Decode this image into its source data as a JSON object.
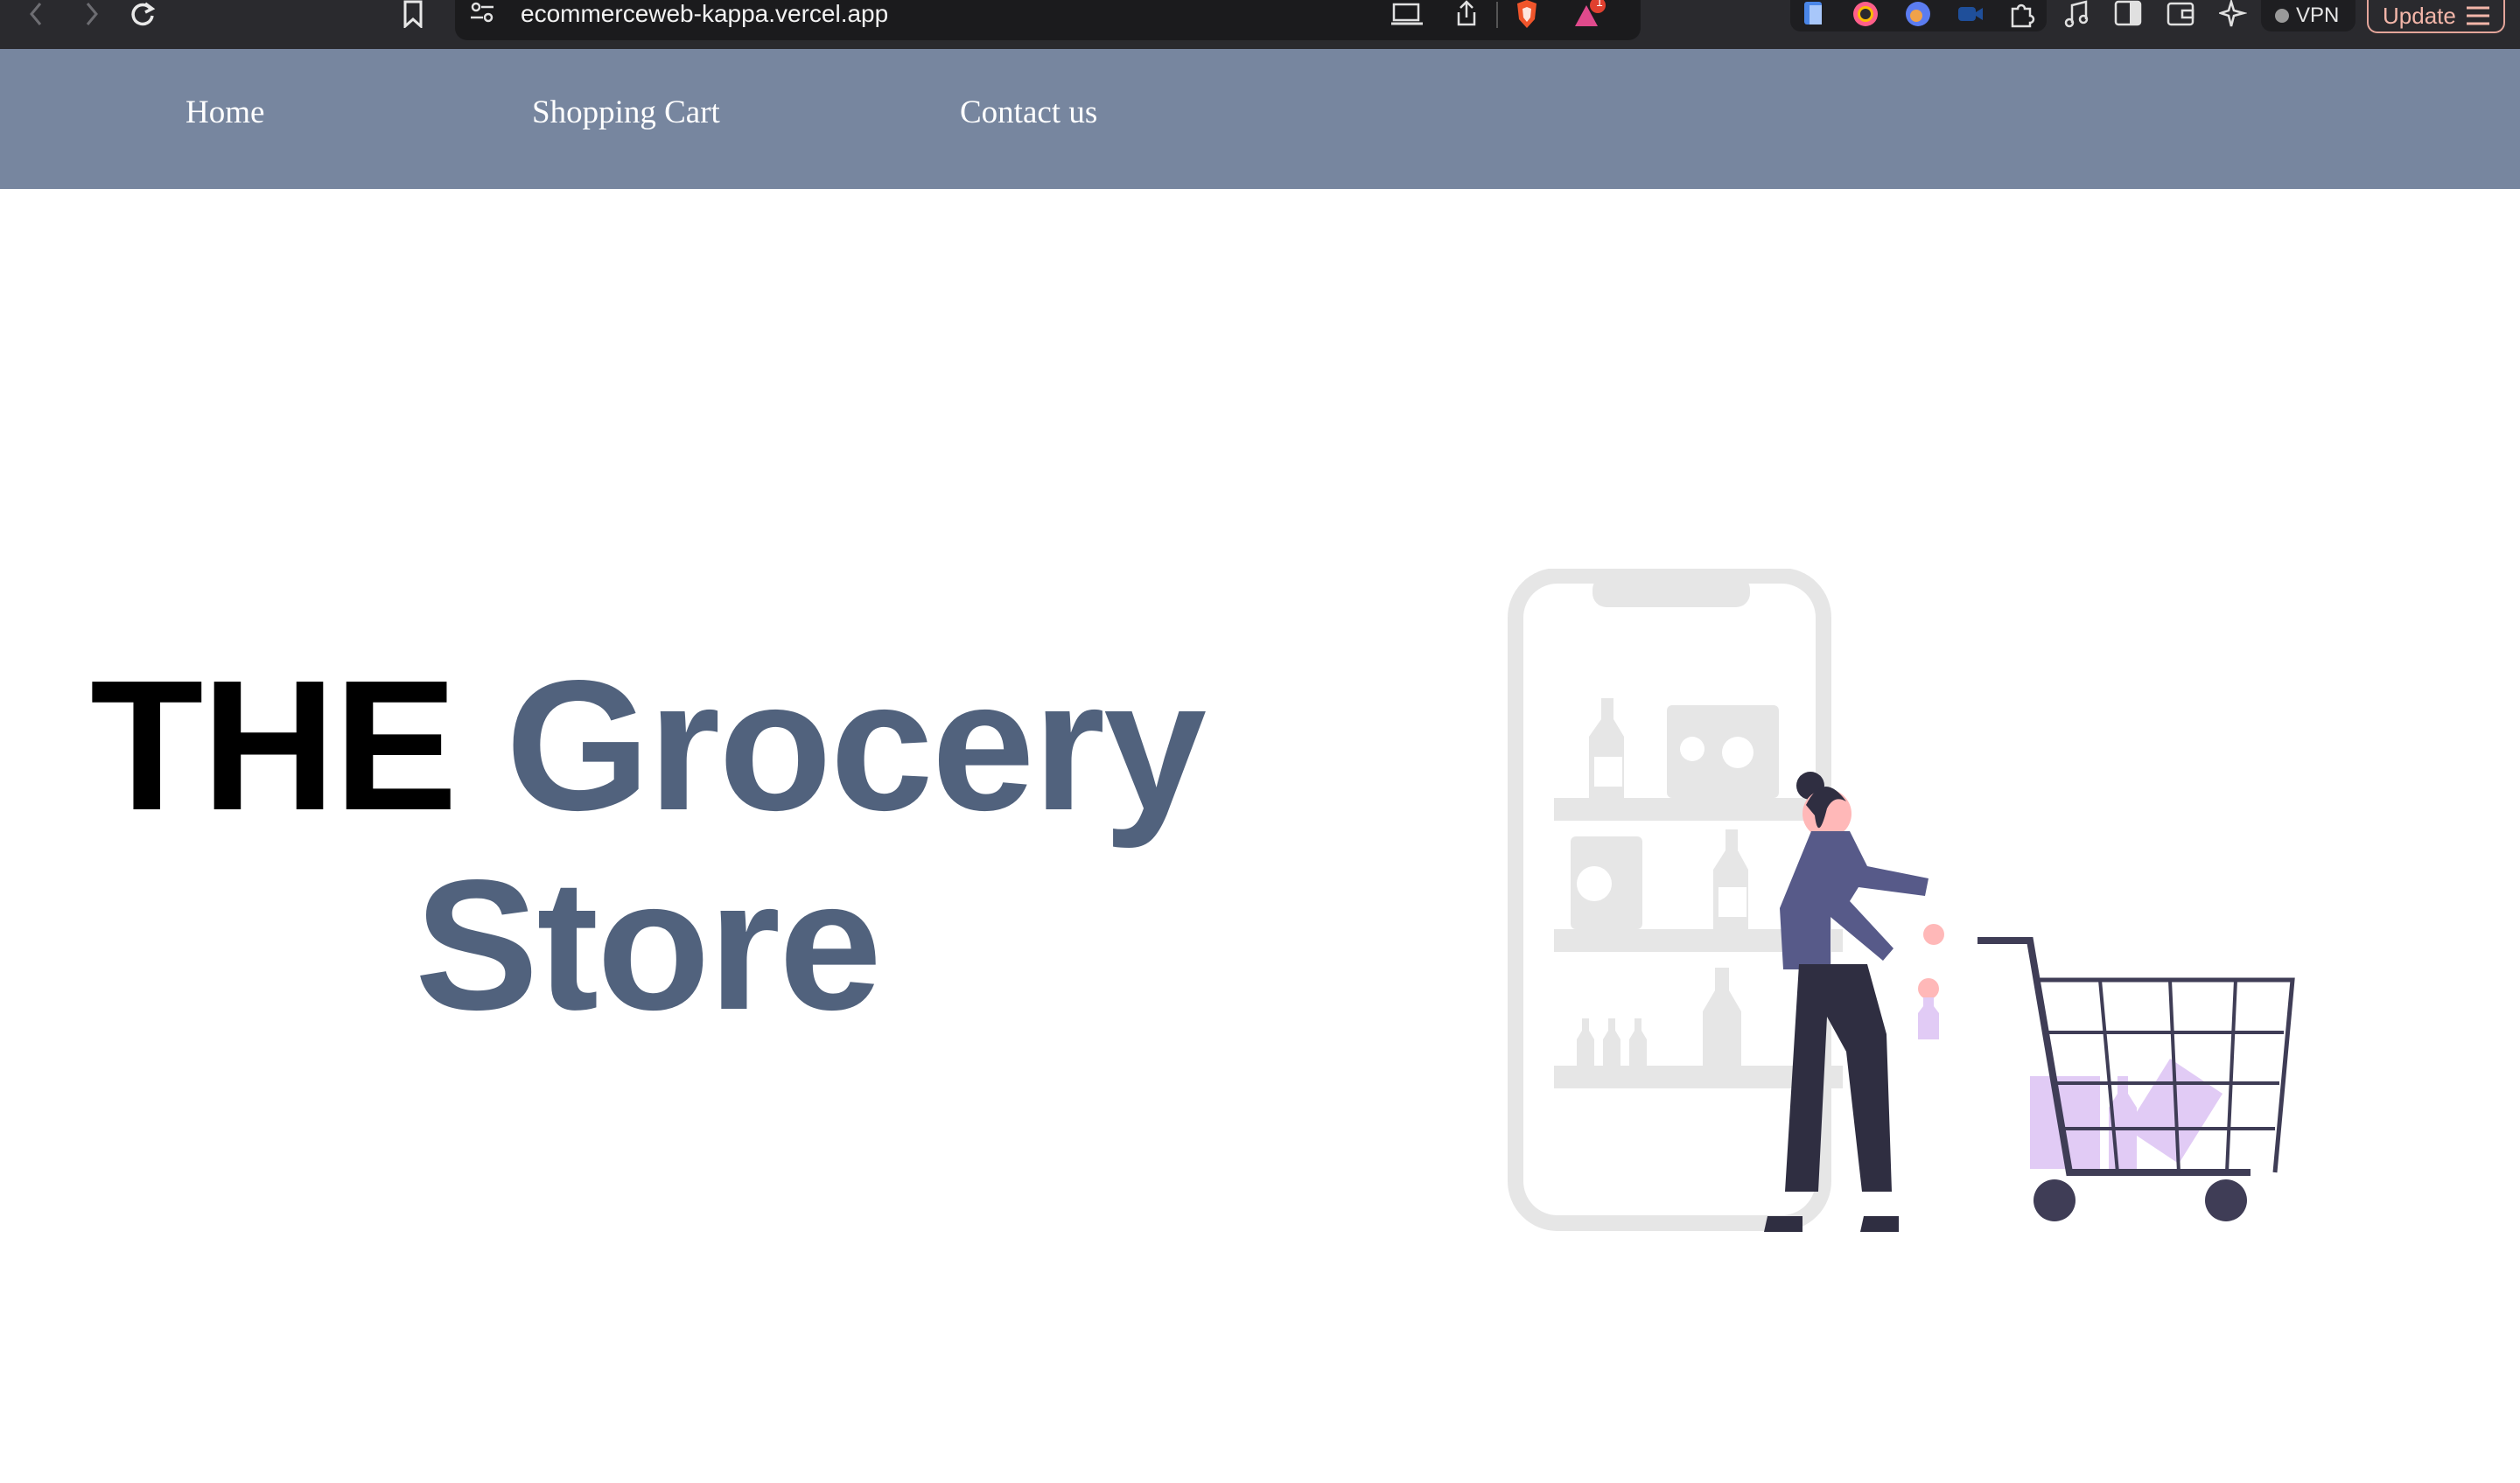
{
  "browser": {
    "url": "ecommerceweb-kappa.vercel.app",
    "vpn_label": "VPN",
    "update_label": "Update",
    "notification_count": "1"
  },
  "nav": {
    "items": [
      {
        "label": "Home"
      },
      {
        "label": "Shopping Cart"
      },
      {
        "label": "Contact us"
      }
    ],
    "background": "#77869f"
  },
  "hero": {
    "title_part1": "THE",
    "title_part2": "Grocery",
    "title_part3": "Store",
    "accent_color": "#51627d"
  },
  "illustration": {
    "icon": "shopping-cart-woman-illustration",
    "accent": "#e1cbf5"
  }
}
